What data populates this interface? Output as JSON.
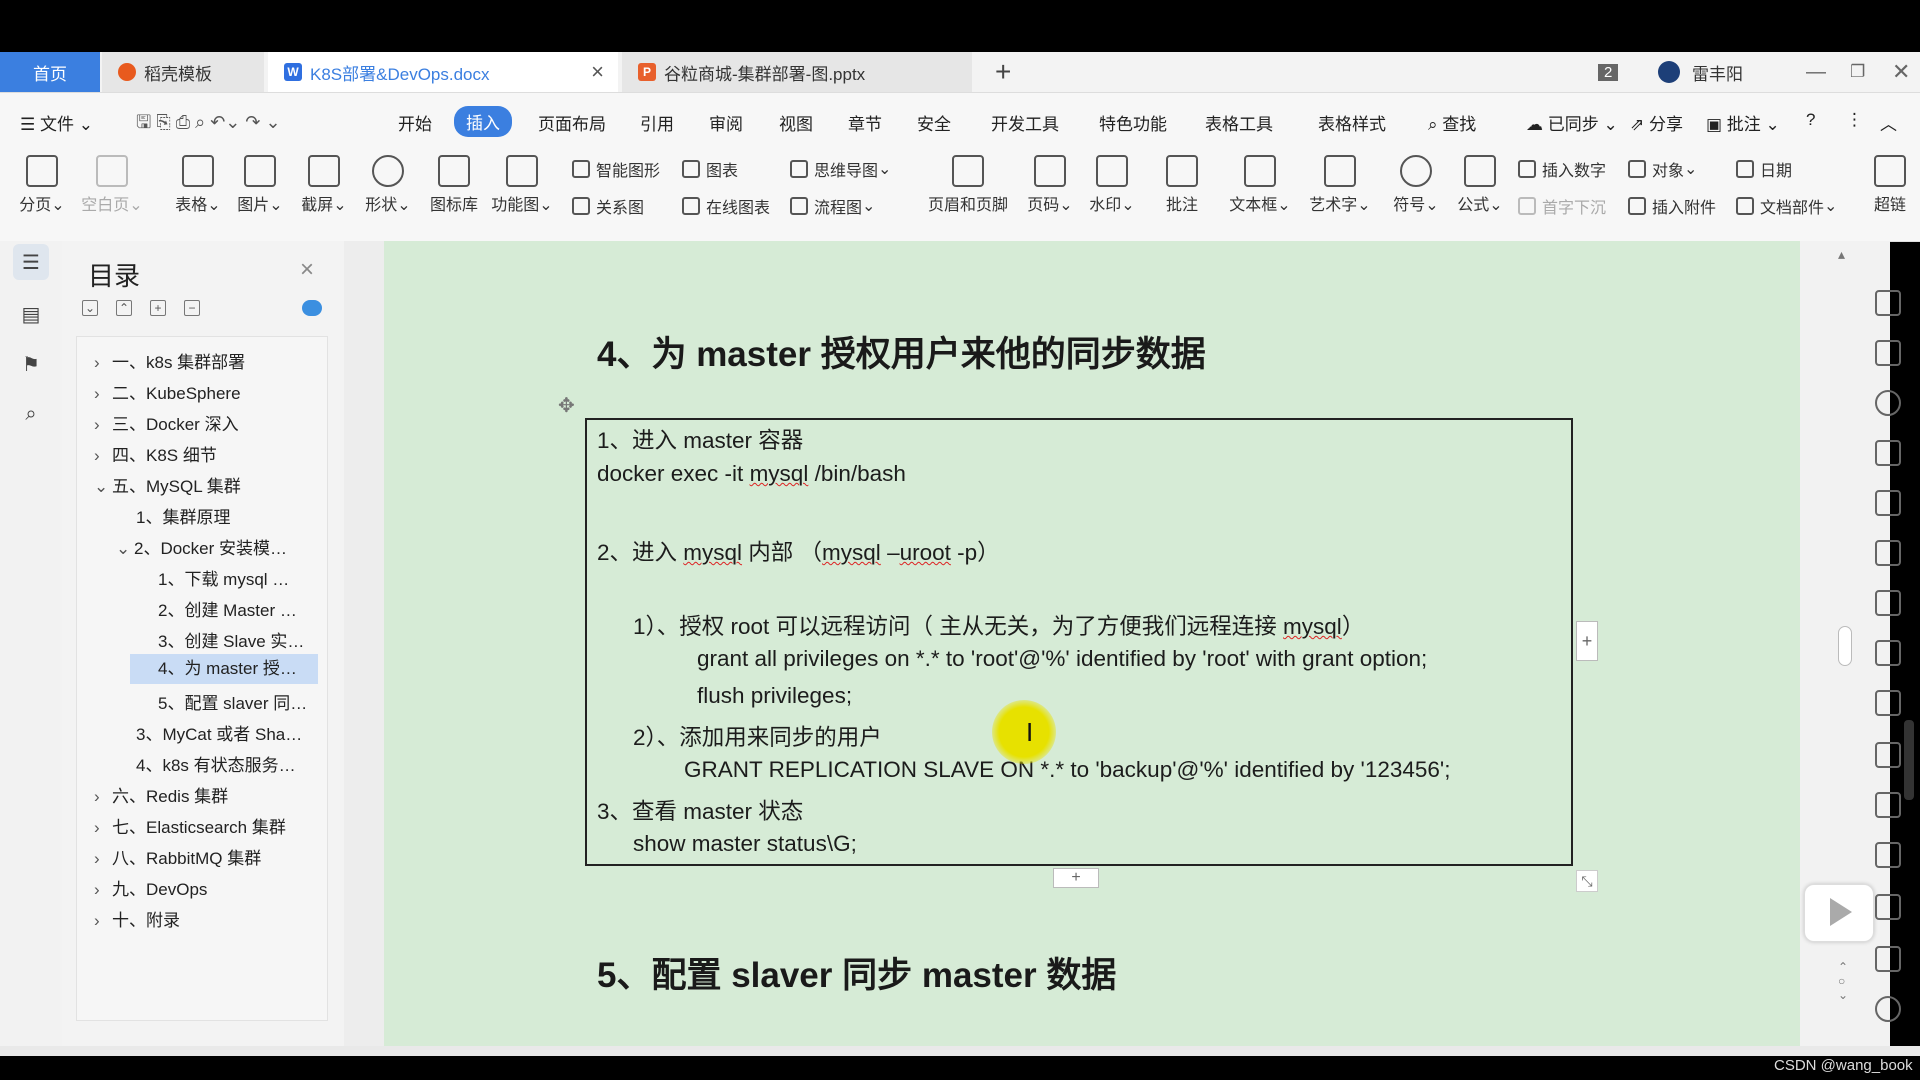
{
  "tabs": {
    "home": "首页",
    "t1": "稻壳模板",
    "t2": "K8S部署&DevOps.docx",
    "t3": "谷粒商城-集群部署-图.pptx",
    "new": "+",
    "badge": "2",
    "user": "雷丰阳"
  },
  "menu": {
    "file": "文件",
    "items": [
      "开始",
      "插入",
      "页面布局",
      "引用",
      "审阅",
      "视图",
      "章节",
      "安全",
      "开发工具",
      "特色功能",
      "表格工具",
      "表格样式"
    ],
    "search": "查找",
    "synced": "已同步",
    "share": "分享",
    "comment": "批注",
    "help": "?"
  },
  "tools": {
    "pagebreak": "分页",
    "blankpage": "空白页",
    "table": "表格",
    "picture": "图片",
    "screenshot": "截屏",
    "shape": "形状",
    "iconlib": "图标库",
    "funcchart": "功能图",
    "smartart": "智能图形",
    "chart": "图表",
    "mindmap": "思维导图",
    "relation": "关系图",
    "onlinechart": "在线图表",
    "flowchart": "流程图",
    "headerfooter": "页眉和页脚",
    "pagenum": "页码",
    "watermark": "水印",
    "annot": "批注",
    "textbox": "文本框",
    "wordart": "艺术字",
    "symbol": "符号",
    "formula": "公式",
    "insertnum": "插入数字",
    "object": "对象",
    "date": "日期",
    "dropcap": "首字下沉",
    "attach": "插入附件",
    "docpart": "文档部件",
    "hyperlink": "超链"
  },
  "toc": {
    "title": "目录",
    "close": "×",
    "items": [
      {
        "chev": "›",
        "text": "一、k8s 集群部署"
      },
      {
        "chev": "›",
        "text": "二、KubeSphere"
      },
      {
        "chev": "›",
        "text": "三、Docker 深入"
      },
      {
        "chev": "›",
        "text": "四、K8S 细节"
      },
      {
        "chev": "⌄",
        "text": "五、MySQL 集群"
      },
      {
        "chev": "",
        "text": "1、集群原理"
      },
      {
        "chev": "⌄",
        "text": "2、Docker 安装模…"
      },
      {
        "chev": "",
        "text": "1、下载 mysql …"
      },
      {
        "chev": "",
        "text": "2、创建 Master …"
      },
      {
        "chev": "",
        "text": "3、创建 Slave 实…"
      },
      {
        "chev": "",
        "text": "4、为 master 授…"
      },
      {
        "chev": "",
        "text": "5、配置 slaver 同…"
      },
      {
        "chev": "",
        "text": "3、MyCat 或者 Sha…"
      },
      {
        "chev": "",
        "text": "4、k8s 有状态服务…"
      },
      {
        "chev": "›",
        "text": "六、Redis 集群"
      },
      {
        "chev": "›",
        "text": "七、Elasticsearch 集群"
      },
      {
        "chev": "›",
        "text": "八、RabbitMQ 集群"
      },
      {
        "chev": "›",
        "text": "九、DevOps"
      },
      {
        "chev": "›",
        "text": "十、附录"
      }
    ]
  },
  "doc": {
    "h4": "4、为 master 授权用户来他的同步数据",
    "h5": "5、配置 slaver 同步 master 数据",
    "lines": {
      "l1": "1、进入 master 容器",
      "l2a": "docker exec -it ",
      "l2b": "mysql",
      "l2c": " /bin/bash",
      "l3a": "2、进入 ",
      "l3b": "mysql",
      "l3c": " 内部 （",
      "l3d": "mysql",
      "l3e": " –",
      "l3f": "uroot",
      "l3g": " -p）",
      "l4a": "1）、授权 root 可以远程访问（ 主从无关，为了方便我们远程连接 ",
      "l4b": "mysql",
      "l4c": "）",
      "l5": "grant all privileges on *.* to 'root'@'%' identified by 'root' with grant option;",
      "l6": "flush privileges;",
      "l7": "2）、添加用来同步的用户",
      "l8": "GRANT REPLICATION SLAVE ON *.* to 'backup'@'%' identified by '123456';",
      "l9": "3、查看 master 状态",
      "l10": "show master status\\G;"
    }
  },
  "watermark": "CSDN @wang_book",
  "colors": {
    "accent": "#3b7fe0",
    "page": "#d6ebd6"
  }
}
